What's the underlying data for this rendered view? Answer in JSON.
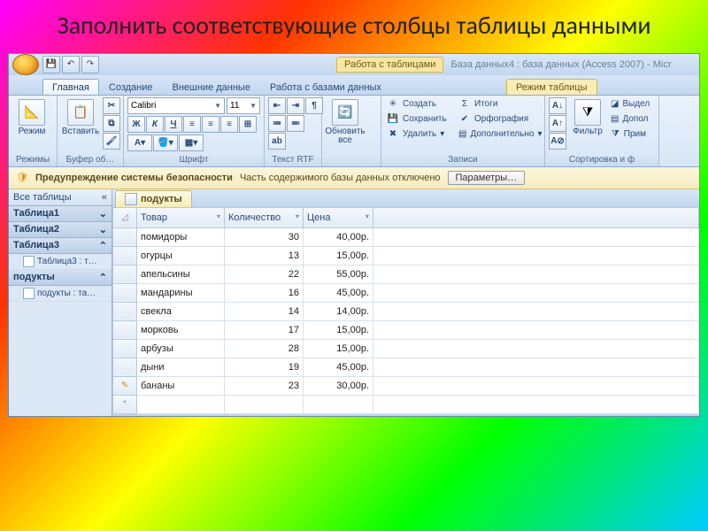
{
  "slide_title": "Заполнить соответствующие столбцы таблицы данными",
  "titlebar": {
    "context": "Работа с таблицами",
    "caption": "База данных4 : база данных (Access 2007) - Micr"
  },
  "tabs": {
    "t0": "Главная",
    "t1": "Создание",
    "t2": "Внешние данные",
    "t3": "Работа с базами данных",
    "ctx": "Режим таблицы"
  },
  "ribbon": {
    "g_modes": "Режимы",
    "g_clip": "Буфер об…",
    "g_font": "Шрифт",
    "g_rtf": "Текст RTF",
    "g_rec": "Записи",
    "g_sort": "Сортировка и ф",
    "mode": "Режим",
    "paste": "Вставить",
    "refresh": "Обновить все",
    "filter": "Фильтр",
    "font_name": "Calibri",
    "font_size": "11",
    "create": "Создать",
    "save": "Сохранить",
    "delete": "Удалить",
    "totals": "Итоги",
    "spell": "Орфография",
    "more": "Дополнительно",
    "sel": "Выдел",
    "adv": "Допол",
    "tog": "Прим"
  },
  "security": {
    "title": "Предупреждение системы безопасности",
    "msg": "Часть содержимого базы данных отключено",
    "btn": "Параметры…"
  },
  "nav": {
    "header": "Все таблицы",
    "g1": "Таблица1",
    "g2": "Таблица2",
    "g3": "Таблица3",
    "g3i": "Таблица3 : т…",
    "g4": "подукты",
    "g4i": "подукты : та…"
  },
  "datatab": "подукты",
  "columns": {
    "c1": "Товар",
    "c2": "Количество",
    "c3": "Цена"
  },
  "rows": [
    {
      "name": "помидоры",
      "qty": "30",
      "price": "40,00р."
    },
    {
      "name": "огурцы",
      "qty": "13",
      "price": "15,00р."
    },
    {
      "name": "апельсины",
      "qty": "22",
      "price": "55,00р."
    },
    {
      "name": "мандарины",
      "qty": "16",
      "price": "45,00р."
    },
    {
      "name": "свекла",
      "qty": "14",
      "price": "14,00р."
    },
    {
      "name": "морковь",
      "qty": "17",
      "price": "15,00р."
    },
    {
      "name": "арбузы",
      "qty": "28",
      "price": "15,00р."
    },
    {
      "name": "дыни",
      "qty": "19",
      "price": "45,00р."
    },
    {
      "name": "бананы",
      "qty": "23",
      "price": "30,00р."
    }
  ]
}
